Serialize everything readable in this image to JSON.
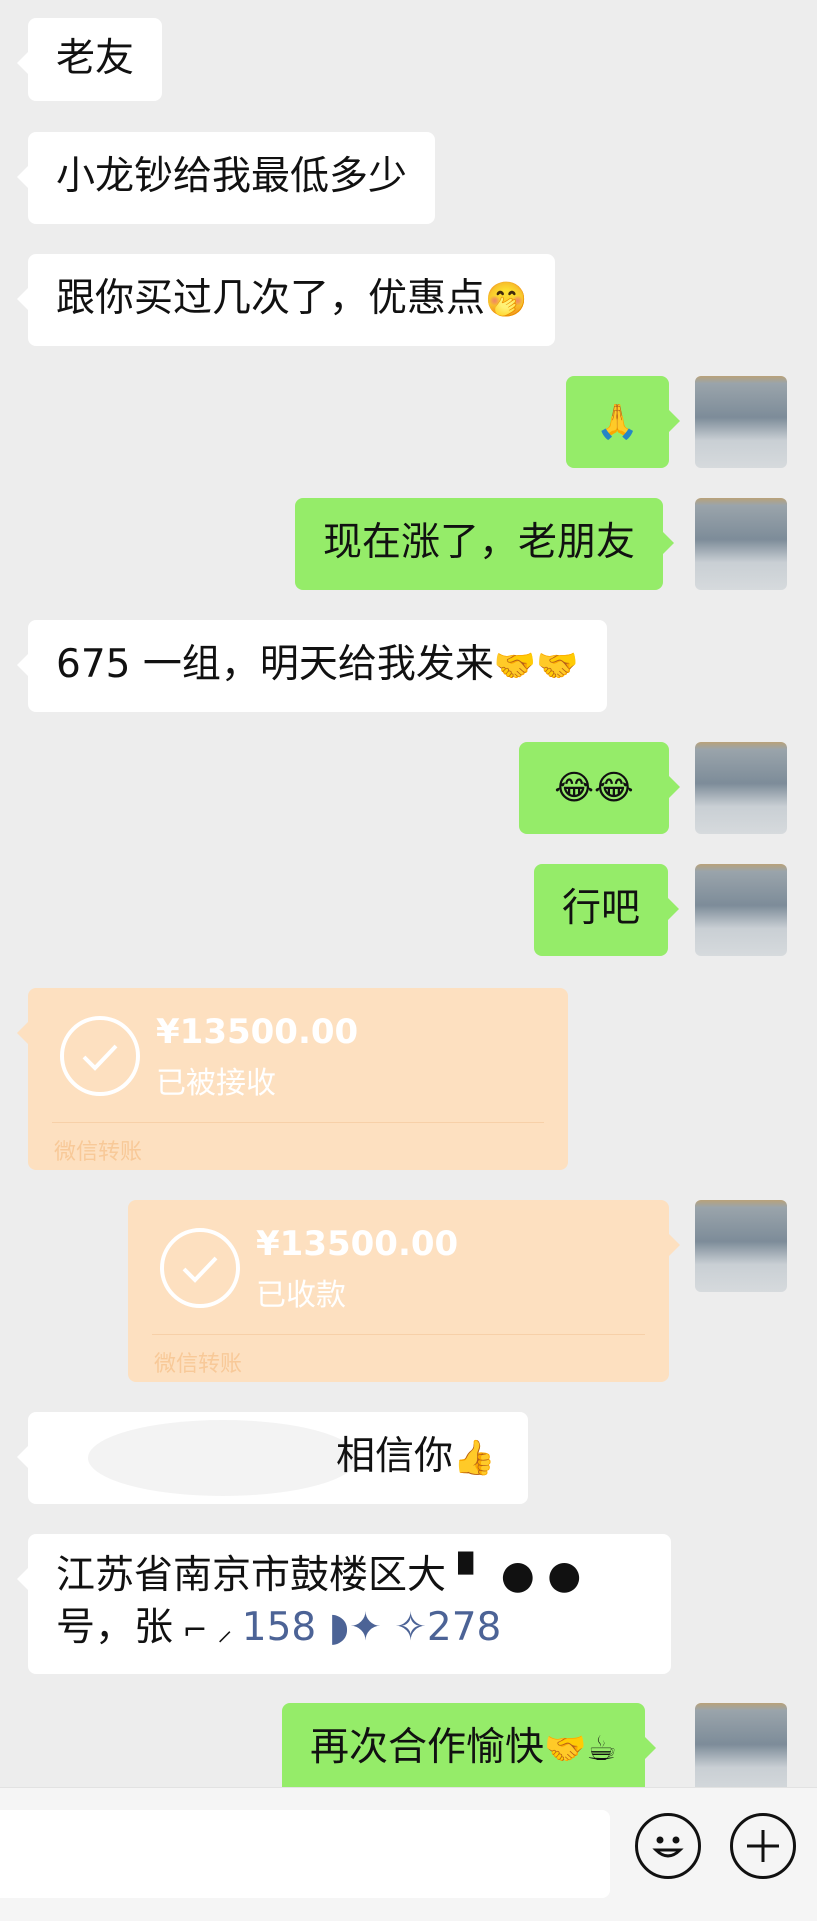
{
  "messages": [
    {
      "side": "in",
      "text": "老友"
    },
    {
      "side": "in",
      "text": "小龙钞给我最低多少"
    },
    {
      "side": "in",
      "text": "跟你买过几次了，优惠点",
      "emoji": "🤭"
    },
    {
      "side": "out",
      "text": "",
      "emoji": "🙏"
    },
    {
      "side": "out",
      "text": "现在涨了，老朋友"
    },
    {
      "side": "in",
      "text": "675 一组，明天给我发来",
      "emoji": "🤝🤝"
    },
    {
      "side": "out",
      "text": "",
      "emoji": "😂😂"
    },
    {
      "side": "out",
      "text": "行吧"
    },
    {
      "side": "in",
      "type": "transfer",
      "amount": "¥13500.00",
      "status": "已被接收",
      "footer": "微信转账"
    },
    {
      "side": "out",
      "type": "transfer",
      "amount": "¥13500.00",
      "status": "已收款",
      "footer": "微信转账"
    },
    {
      "side": "in",
      "text": "相信你",
      "emoji": "👍"
    },
    {
      "side": "in",
      "line1": "江苏省南京市鼓楼区大",
      "line2_prefix": "号，张",
      "phone_prefix": "158",
      "phone_suffix": "278"
    },
    {
      "side": "out",
      "text": "再次合作愉快",
      "emoji": "🤝☕"
    }
  ],
  "input_bar": {
    "placeholder": ""
  }
}
